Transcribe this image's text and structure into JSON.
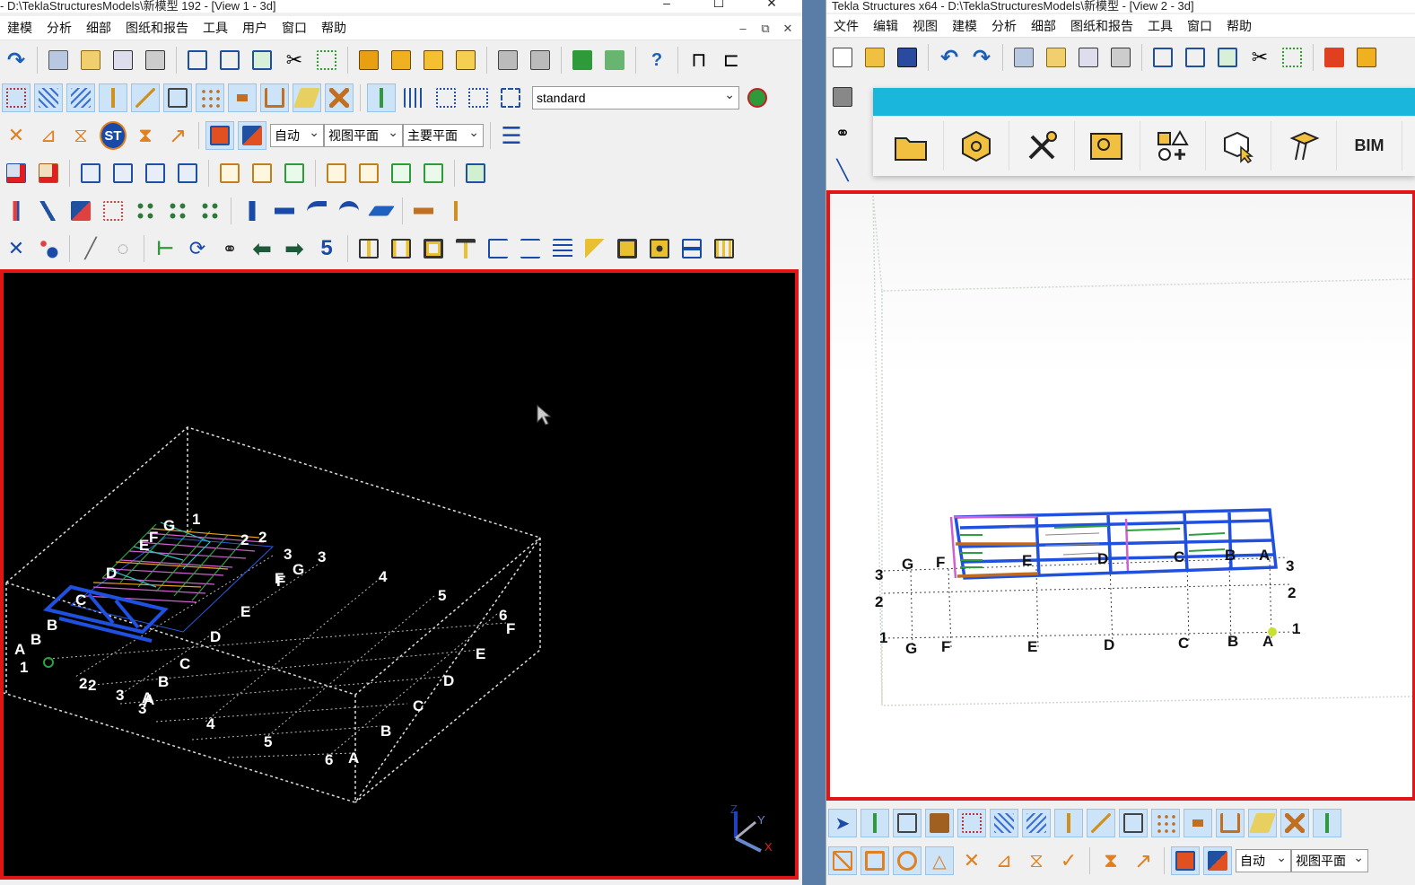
{
  "left_window": {
    "title": "- D:\\TeklaStructuresModels\\新模型 192 - [View 1 - 3d]",
    "menu": [
      "建模",
      "分析",
      "细部",
      "图纸和报告",
      "工具",
      "用户",
      "窗口",
      "帮助"
    ],
    "profile_combo": "standard",
    "toolbar_combos": [
      "自动",
      "视图平面",
      "主要平面"
    ],
    "toolbar_number_button": "5",
    "st_button": "ST",
    "viewport": {
      "grid_letters_top": [
        "G",
        "F",
        "E",
        "D",
        "B",
        "A",
        "1",
        "2",
        "3"
      ],
      "labels": [
        "G",
        "1",
        "2",
        "2",
        "E",
        "F",
        "F",
        "3",
        "3",
        "G",
        "4",
        "5",
        "F",
        "6",
        "F",
        "E",
        "D",
        "E",
        "D",
        "D",
        "C",
        "B",
        "A",
        "B",
        "A",
        "1",
        "2",
        "2",
        "3",
        "A",
        "B",
        "3",
        "C",
        "4",
        "5",
        "6",
        "A",
        "B",
        "C"
      ],
      "axis_labels": [
        "Z",
        "Y",
        "X"
      ]
    }
  },
  "right_window": {
    "title": "Tekla Structures x64 - D:\\TeklaStructuresModels\\新模型 - [View 2 - 3d]",
    "menu": [
      "文件",
      "编辑",
      "视图",
      "建模",
      "分析",
      "细部",
      "图纸和报告",
      "工具",
      "窗口",
      "帮助"
    ],
    "ribbon_items": [
      "open-folder",
      "component",
      "tools",
      "drawing-settings",
      "shapes-add",
      "select-object",
      "bolt",
      "BIM"
    ],
    "ribbon_bim_label": "BIM",
    "bottom_combos": [
      "自动",
      "视图平面"
    ],
    "viewport": {
      "labels": [
        "G",
        "F",
        "E",
        "D",
        "C",
        "B",
        "A",
        "3",
        "2",
        "1",
        "3",
        "2",
        "1",
        "G",
        "F",
        "E",
        "D",
        "C",
        "B",
        "A"
      ]
    }
  },
  "colors": {
    "active_view_border": "#e01515",
    "ribbon_bar": "#1bb6dc",
    "desktop": "#5a7da8"
  }
}
